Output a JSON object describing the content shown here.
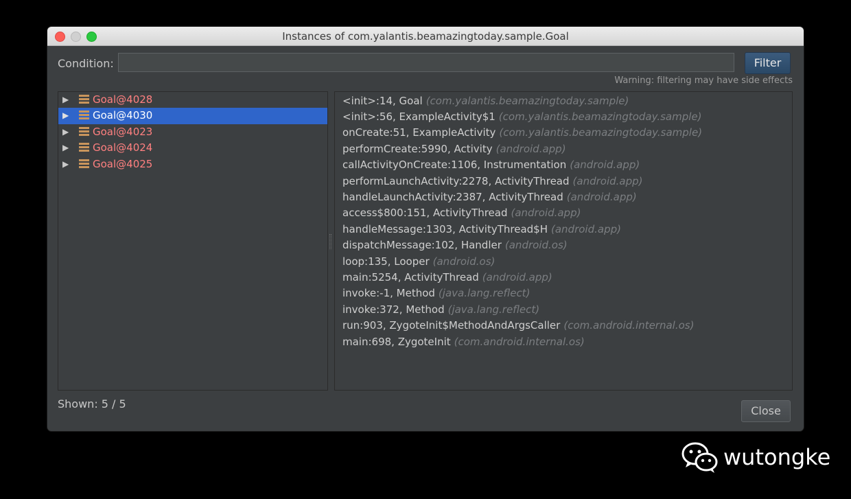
{
  "window": {
    "title": "Instances of com.yalantis.beamazingtoday.sample.Goal"
  },
  "filter": {
    "label": "Condition:",
    "value": "",
    "button_label": "Filter",
    "warning": "Warning: filtering may have side effects"
  },
  "instances": [
    {
      "label": "Goal@4028",
      "selected": false
    },
    {
      "label": "Goal@4030",
      "selected": true
    },
    {
      "label": "Goal@4023",
      "selected": false
    },
    {
      "label": "Goal@4024",
      "selected": false
    },
    {
      "label": "Goal@4025",
      "selected": false
    }
  ],
  "frames": [
    {
      "method": "<init>:14, Goal",
      "package": "(com.yalantis.beamazingtoday.sample)"
    },
    {
      "method": "<init>:56, ExampleActivity$1",
      "package": "(com.yalantis.beamazingtoday.sample)"
    },
    {
      "method": "onCreate:51, ExampleActivity",
      "package": "(com.yalantis.beamazingtoday.sample)"
    },
    {
      "method": "performCreate:5990, Activity",
      "package": "(android.app)"
    },
    {
      "method": "callActivityOnCreate:1106, Instrumentation",
      "package": "(android.app)"
    },
    {
      "method": "performLaunchActivity:2278, ActivityThread",
      "package": "(android.app)"
    },
    {
      "method": "handleLaunchActivity:2387, ActivityThread",
      "package": "(android.app)"
    },
    {
      "method": "access$800:151, ActivityThread",
      "package": "(android.app)"
    },
    {
      "method": "handleMessage:1303, ActivityThread$H",
      "package": "(android.app)"
    },
    {
      "method": "dispatchMessage:102, Handler",
      "package": "(android.os)"
    },
    {
      "method": "loop:135, Looper",
      "package": "(android.os)"
    },
    {
      "method": "main:5254, ActivityThread",
      "package": "(android.app)"
    },
    {
      "method": "invoke:-1, Method",
      "package": "(java.lang.reflect)"
    },
    {
      "method": "invoke:372, Method",
      "package": "(java.lang.reflect)"
    },
    {
      "method": "run:903, ZygoteInit$MethodAndArgsCaller",
      "package": "(com.android.internal.os)"
    },
    {
      "method": "main:698, ZygoteInit",
      "package": "(com.android.internal.os)"
    }
  ],
  "footer": {
    "shown": "Shown: 5 / 5",
    "close_label": "Close"
  },
  "watermark": {
    "text": "wutongke"
  },
  "colors": {
    "selection": "#2f65ca",
    "instance_text": "#ff8080",
    "filter_button": "#2f4f72",
    "package_text": "#7b7e81"
  },
  "icons": {
    "expand": "triangle-right-icon",
    "instance": "object-stack-icon"
  }
}
